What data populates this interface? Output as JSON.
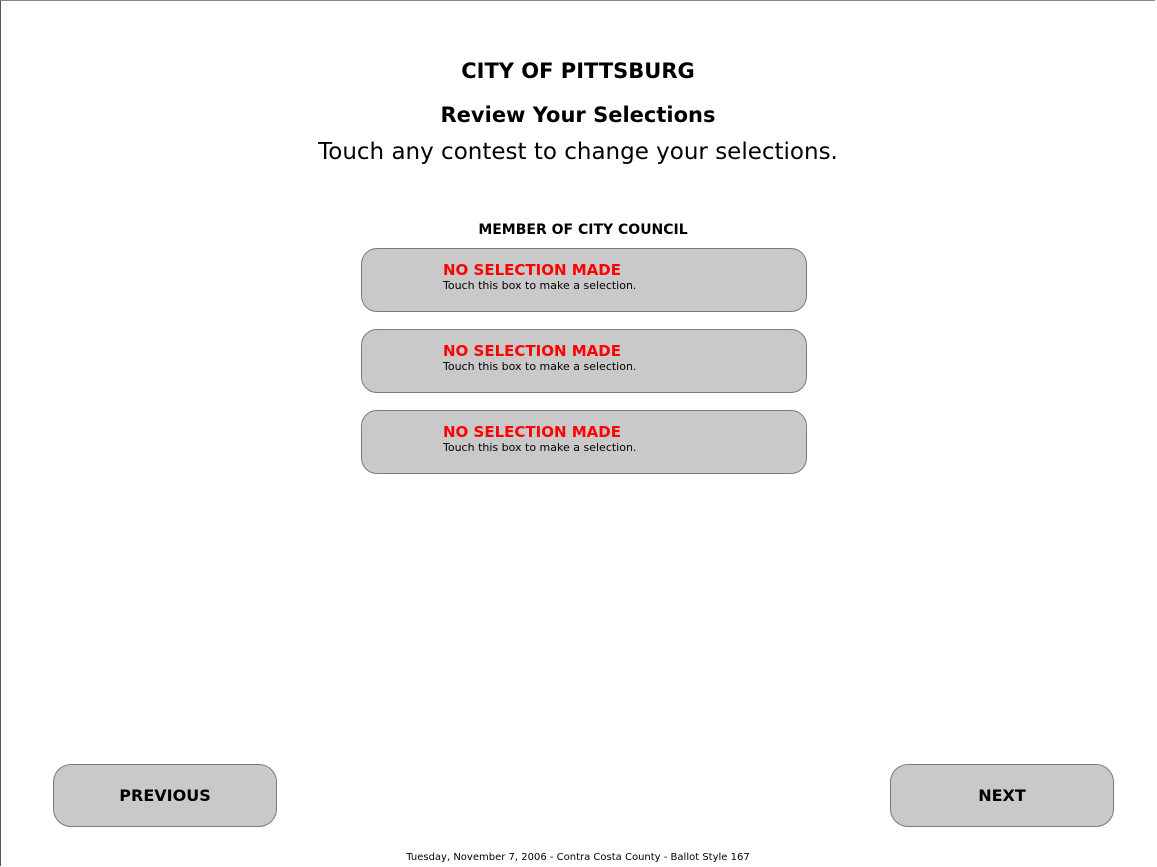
{
  "header": {
    "jurisdiction": "CITY OF PITTSBURG",
    "title": "Review Your Selections",
    "instructions": "Touch any contest to change your selections."
  },
  "contest": {
    "title": "MEMBER OF CITY COUNCIL",
    "selections": [
      {
        "status": "NO SELECTION MADE",
        "hint": "Touch this box to make a selection."
      },
      {
        "status": "NO SELECTION MADE",
        "hint": "Touch this box to make a selection."
      },
      {
        "status": "NO SELECTION MADE",
        "hint": "Touch this box to make a selection."
      }
    ]
  },
  "nav": {
    "previous_label": "PREVIOUS",
    "next_label": "NEXT"
  },
  "footer": {
    "text": "Tuesday, November 7, 2006 - Contra Costa County - Ballot Style 167"
  },
  "colors": {
    "background": "#ffffff",
    "box_fill": "#c9c9c9",
    "no_selection_text": "#ff0000"
  }
}
